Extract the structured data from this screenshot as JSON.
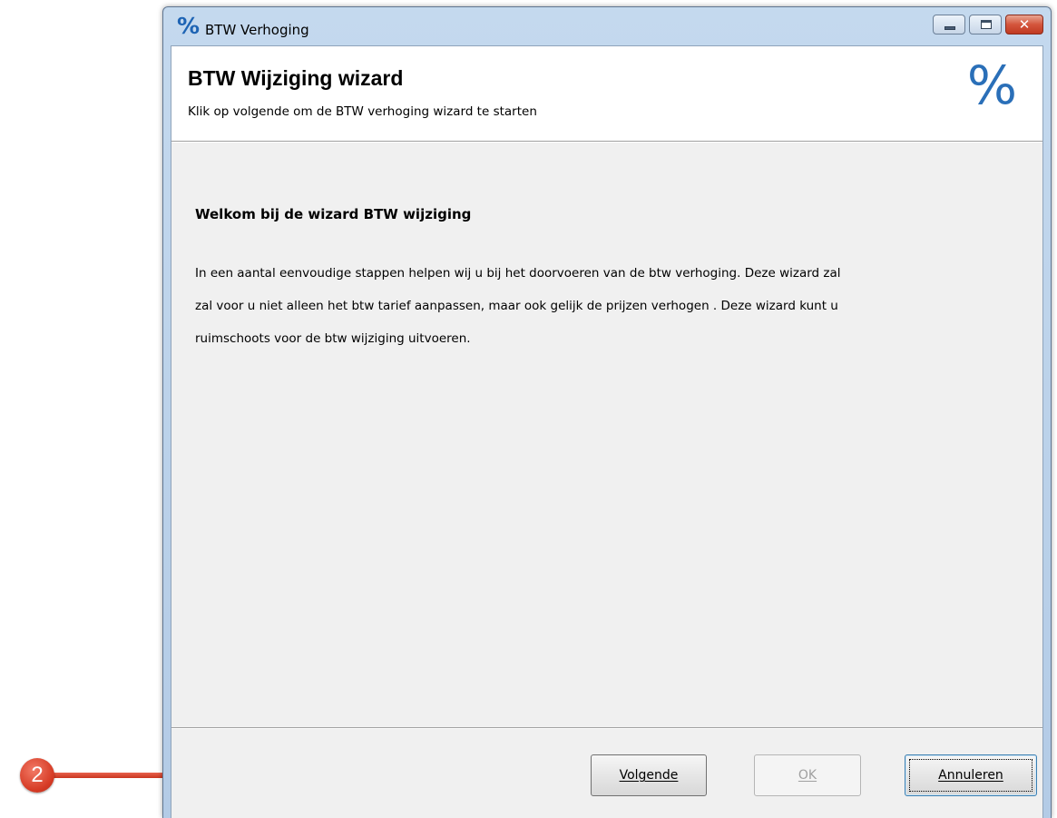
{
  "window": {
    "title": "BTW Verhoging",
    "title_icon_glyph": "%",
    "icon": "percent-icon"
  },
  "header": {
    "title": "BTW Wijziging wizard",
    "subtitle": "Klik op volgende om de BTW verhoging wizard te starten",
    "icon_glyph": "%"
  },
  "content": {
    "welcome_title": "Welkom bij de wizard BTW wijziging",
    "welcome_line_1": "In een aantal eenvoudige stappen helpen wij u bij het doorvoeren van de btw verhoging. Deze wizard zal",
    "welcome_line_2": "zal voor u niet alleen het btw tarief aanpassen, maar ook gelijk de prijzen verhogen . Deze wizard kunt u",
    "welcome_line_3": "ruimschoots voor de btw wijziging uitvoeren."
  },
  "buttons": {
    "next": "Volgende",
    "ok": "OK",
    "cancel": "Annuleren",
    "ok_enabled": false
  },
  "callout": {
    "number": "2",
    "color": "#d63b25"
  },
  "colors": {
    "accent": "#2a6fb8",
    "titlebar": "#b9cfe8"
  }
}
